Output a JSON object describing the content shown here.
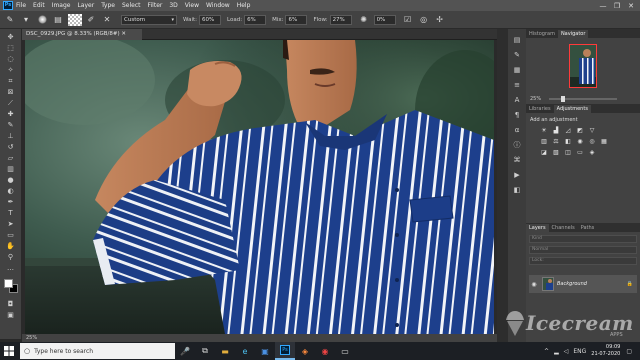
{
  "menubar": {
    "logo": "Ps",
    "items": [
      "File",
      "Edit",
      "Image",
      "Layer",
      "Type",
      "Select",
      "Filter",
      "3D",
      "View",
      "Window",
      "Help"
    ],
    "controls": [
      "—",
      "❐",
      "✕"
    ]
  },
  "options": {
    "mode_value": "Custom",
    "opacity_label": "Wait:",
    "opacity_value": "60%",
    "load_label": "Load:",
    "load_value": "6%",
    "mix_label": "Mix:",
    "mix_value": "6%",
    "flow_label": "Flow:",
    "flow_value": "27%",
    "angle_value": "0%"
  },
  "document": {
    "tab_label": "DSC_0929.JPG @ 8.33% (RGB/8#) ✕",
    "status_zoom": "25%"
  },
  "panels": {
    "top_tabs": [
      "Histogram",
      "Navigator"
    ],
    "nav_zoom": "25%",
    "mid_tabs": [
      "Libraries",
      "Adjustments"
    ],
    "adjust_title": "Add an adjustment",
    "layer_tabs": [
      "Layers",
      "Channels",
      "Paths"
    ],
    "layer_kind": "Kind",
    "layer_mode": "Normal",
    "layer_lock": "Lock:",
    "layer_name": "Background"
  },
  "watermark": {
    "brand": "Icecream",
    "sub": "APPS"
  },
  "taskbar": {
    "search_placeholder": "Type here to search",
    "time": "09:09",
    "date": "21-07-2020"
  },
  "colors": {
    "shirt": "#1d3f8c",
    "stripe": "#f2f4f8",
    "skin": "#c98a62",
    "accent": "#31a8ff"
  }
}
